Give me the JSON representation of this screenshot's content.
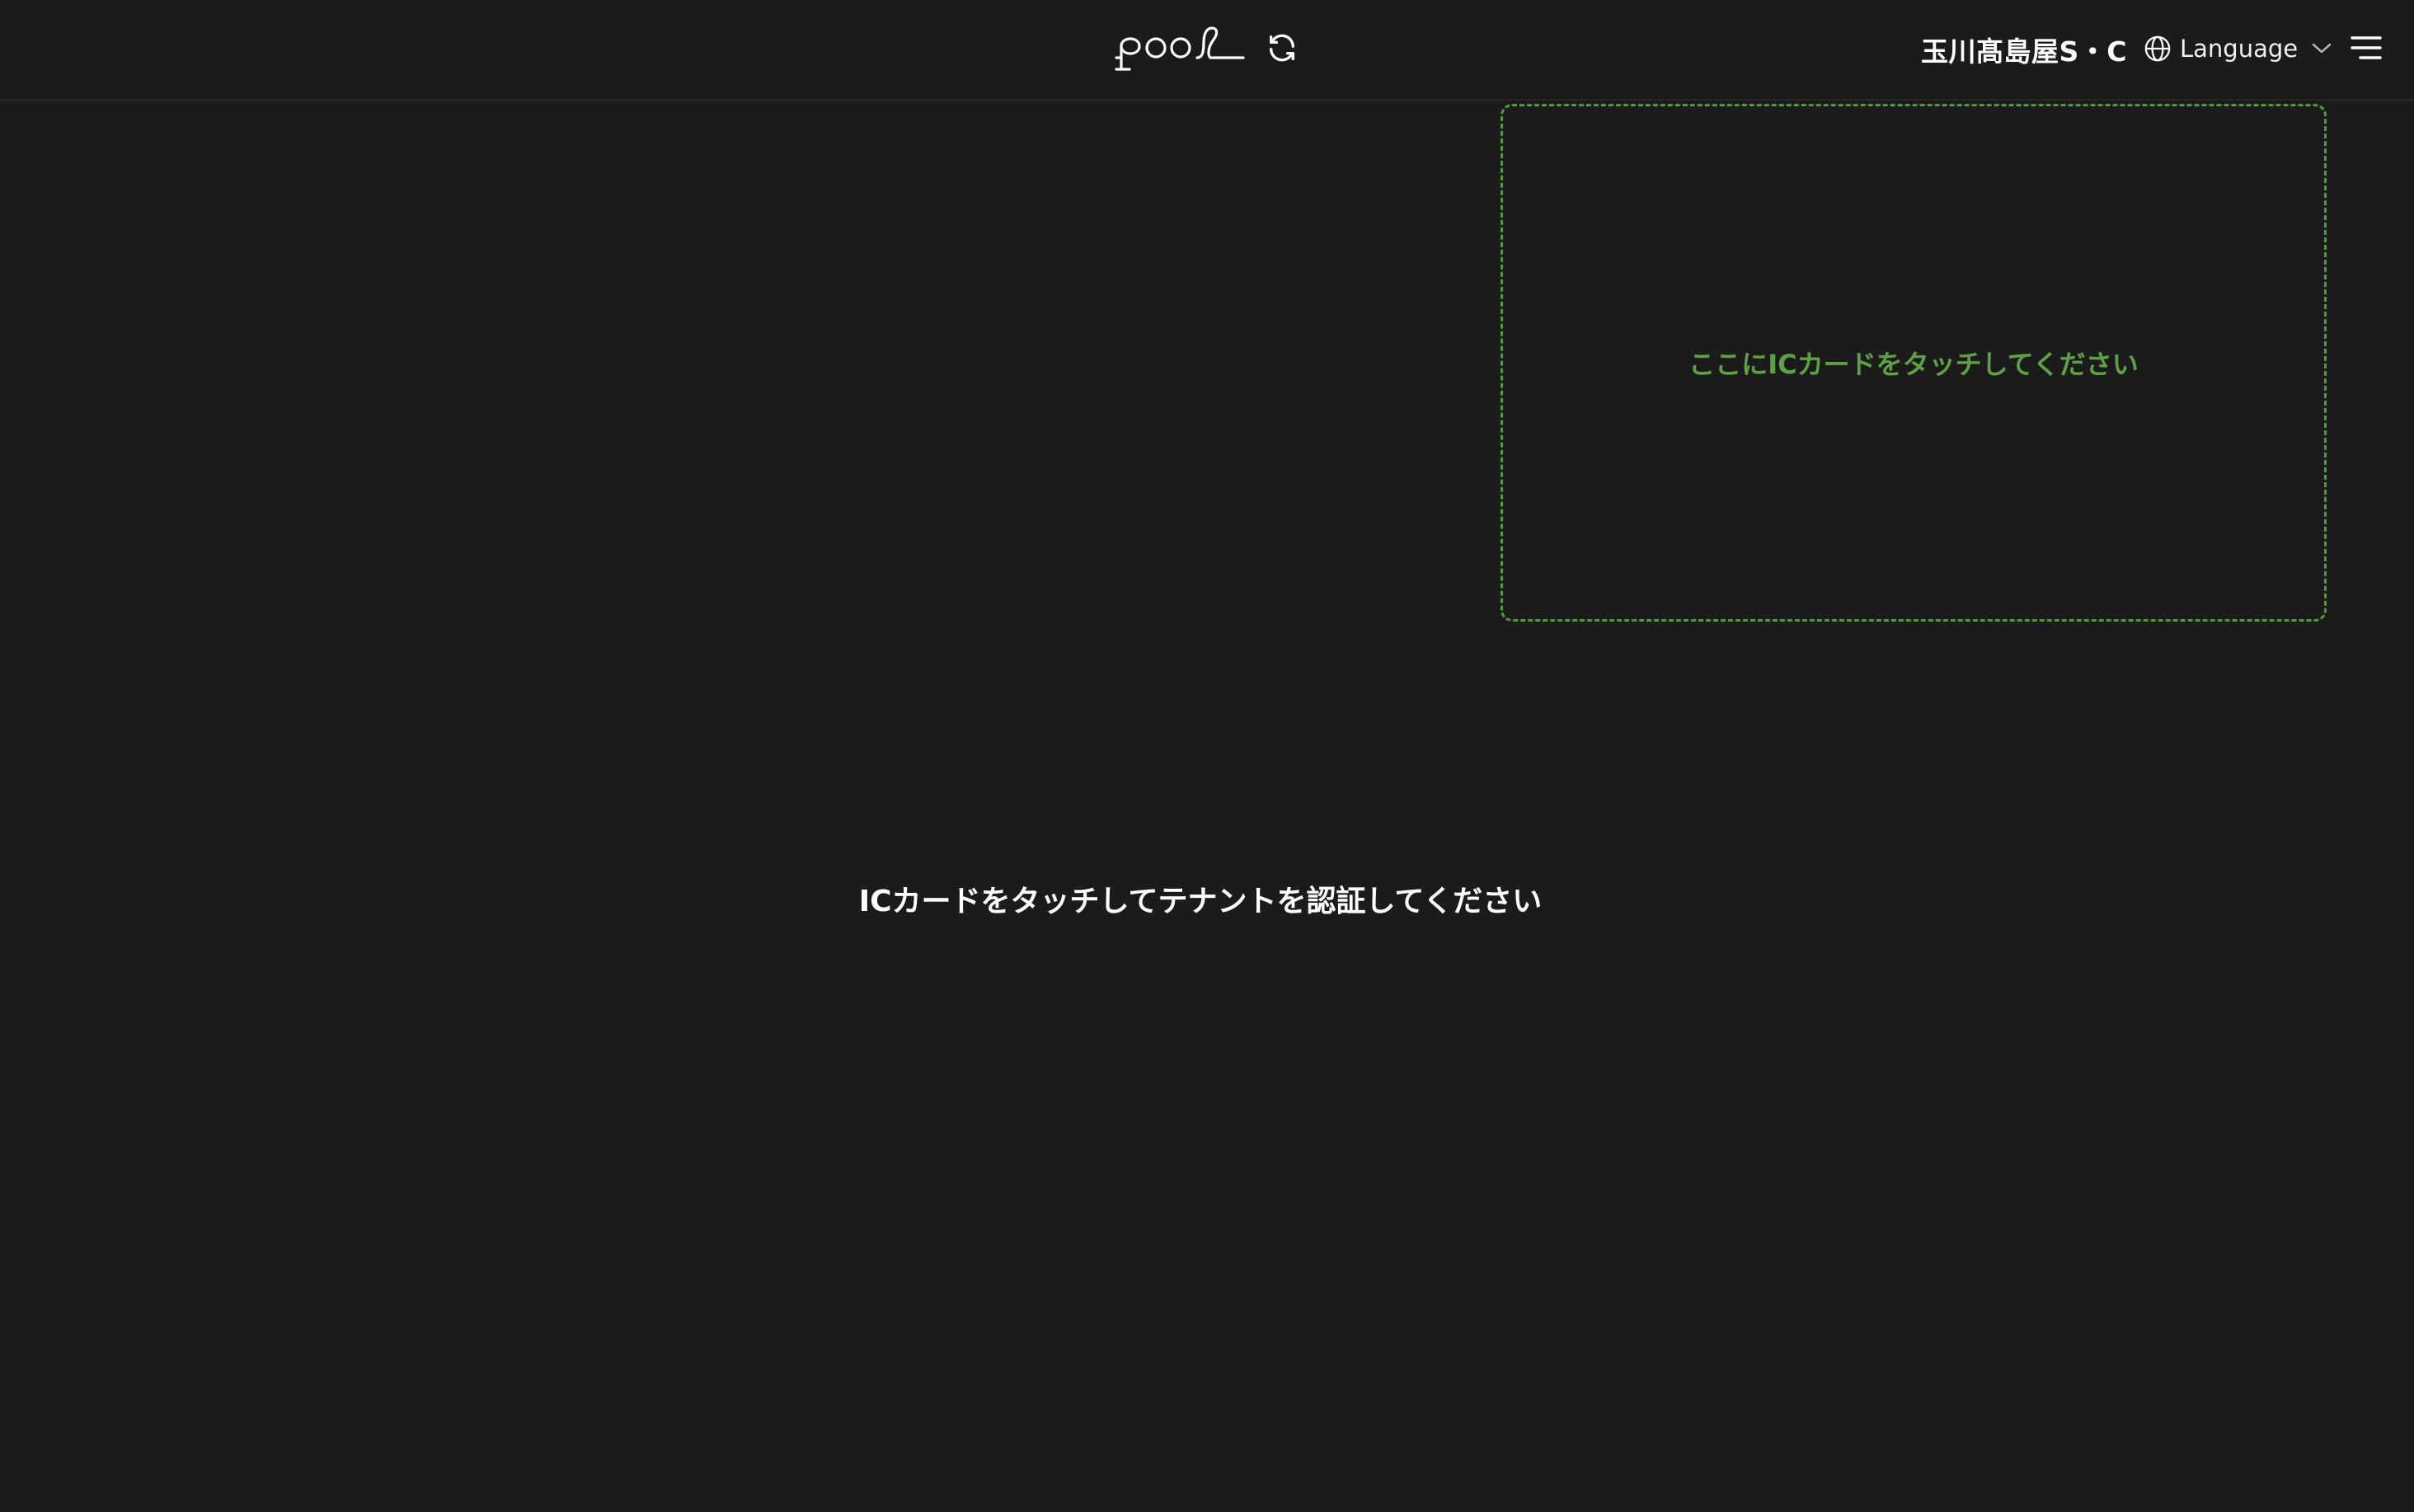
{
  "header": {
    "logo_icon": "pool-logo-icon",
    "refresh_icon": "refresh-icon",
    "store_name": "玉川髙島屋S・C",
    "language": {
      "icon": "globe-icon",
      "label": "Language",
      "chevron_icon": "chevron-down-icon"
    },
    "menu_icon": "hamburger-menu-icon"
  },
  "touch_zone": {
    "prompt": "ここにICカードをタッチしてください",
    "border_color": "#4f9a3a",
    "text_color": "#5fa044"
  },
  "main": {
    "instruction": "ICカードをタッチしてテナントを認証してください"
  },
  "colors": {
    "background": "#1b1b1b",
    "text": "#ffffff"
  }
}
